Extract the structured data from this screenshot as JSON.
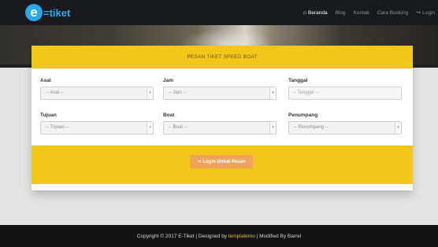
{
  "brand": {
    "logo_letter": "e",
    "logo_text": "=tiket",
    "accent_color": "#2aa6ea"
  },
  "nav": {
    "items": [
      {
        "label": "Beranda",
        "icon": "home-icon",
        "active": true
      },
      {
        "label": "Blog",
        "active": false
      },
      {
        "label": "Kontak",
        "active": false
      },
      {
        "label": "Cara Booking",
        "active": false
      },
      {
        "label": "Login",
        "icon": "login-icon",
        "active": false
      }
    ]
  },
  "form": {
    "title": "PESAN TIKET SPEED BOAT",
    "header_color": "#f3c61a",
    "fields": {
      "asal": {
        "label": "Asal",
        "value": "-- Asal --"
      },
      "jam": {
        "label": "Jam",
        "value": "-- Jam --"
      },
      "tanggal": {
        "label": "Tanggal",
        "placeholder": "-- Tanggal --"
      },
      "tujuan": {
        "label": "Tujuan",
        "value": "-- Tujuan --"
      },
      "boat": {
        "label": "Boat",
        "value": "-- Boat --"
      },
      "penumpang": {
        "label": "Penumpang",
        "value": "-- Penumpang --"
      }
    },
    "submit_label": "Login Untuk Pesan",
    "submit_icon": "login-icon",
    "submit_color": "#f0a35a"
  },
  "footer": {
    "prefix": "Copyright © 2017 E-Tiket | Designed by",
    "link_text": "templatemo",
    "suffix": "| Modified By Barrel"
  }
}
